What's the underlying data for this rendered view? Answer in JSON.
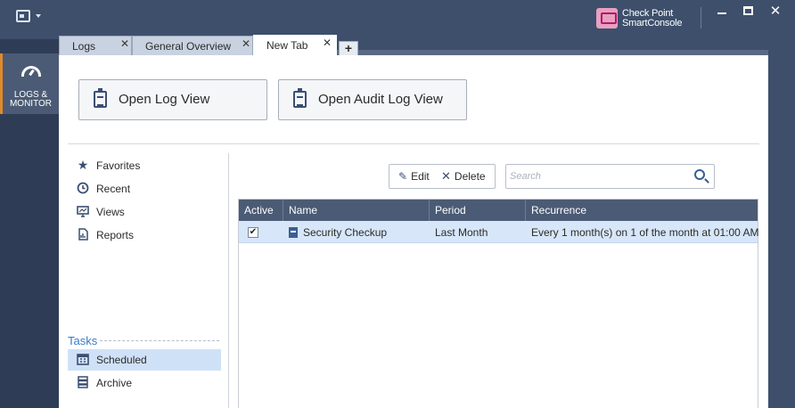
{
  "titlebar": {
    "brand_line1": "Check Point",
    "brand_line2": "SmartConsole",
    "close_glyph": "✕"
  },
  "leftnav": {
    "logs_label_line1": "LOGS &",
    "logs_label_line2": "MONITOR"
  },
  "tabs": [
    {
      "label": "Logs",
      "active": false
    },
    {
      "label": "General Overview",
      "active": false
    },
    {
      "label": "New Tab",
      "active": true
    }
  ],
  "tab_close_glyph": "✕",
  "tab_add_glyph": "+",
  "main": {
    "open_log_view_label": "Open Log View",
    "open_audit_log_view_label": "Open Audit Log View"
  },
  "sidebar": {
    "items": [
      {
        "label": "Favorites",
        "icon": "star-icon"
      },
      {
        "label": "Recent",
        "icon": "clock-icon"
      },
      {
        "label": "Views",
        "icon": "monitor-icon"
      },
      {
        "label": "Reports",
        "icon": "report-icon"
      }
    ],
    "tasks_title": "Tasks",
    "tasks": [
      {
        "label": "Scheduled",
        "icon": "calendar-icon",
        "selected": true
      },
      {
        "label": "Archive",
        "icon": "archive-icon",
        "selected": false
      }
    ]
  },
  "toolbar": {
    "edit_label": "Edit",
    "delete_label": "Delete"
  },
  "search": {
    "placeholder": "Search",
    "value": ""
  },
  "table": {
    "columns": [
      "Active",
      "Name",
      "Period",
      "Recurrence"
    ],
    "rows": [
      {
        "active": true,
        "name": "Security Checkup",
        "period": "Last Month",
        "recurrence": "Every 1 month(s) on 1 of the month at 01:00 AM"
      }
    ]
  },
  "colors": {
    "chrome": "#3d4f6b",
    "accent_orange": "#e08a2a",
    "selection": "#d7e6f8",
    "header": "#4b5b75"
  }
}
